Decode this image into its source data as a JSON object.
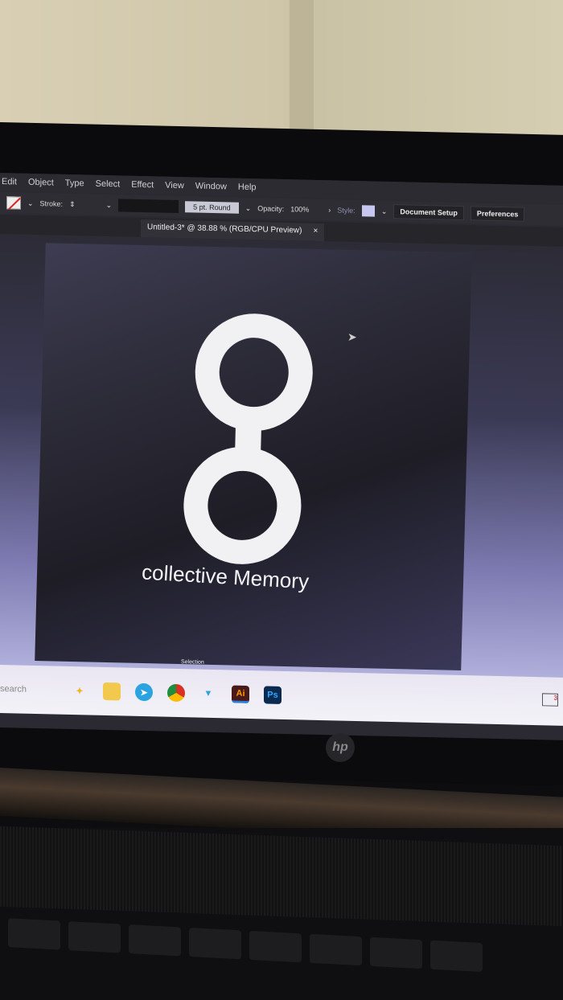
{
  "menu": [
    "Edit",
    "Object",
    "Type",
    "Select",
    "Effect",
    "View",
    "Window",
    "Help"
  ],
  "toolbar": {
    "stroke_label": "Stroke:",
    "brush": "5 pt. Round",
    "opacity_label": "Opacity:",
    "opacity_value": "100%",
    "style_label": "Style:",
    "document_setup": "Document Setup",
    "preferences": "Preferences"
  },
  "document_tab": {
    "title": "Untitled-3* @ 38.88 % (RGB/CPU Preview)",
    "close": "×"
  },
  "artwork": {
    "logo_text": "collective Memory"
  },
  "status": {
    "tool": "Selection"
  },
  "taskbar": {
    "search": "search",
    "apps": [
      "Ai",
      "Ps"
    ],
    "notification_count": "3"
  },
  "laptop": {
    "brand": "hp"
  },
  "colors": {
    "artboard": "#25242f",
    "logo": "#f1f1f3"
  }
}
